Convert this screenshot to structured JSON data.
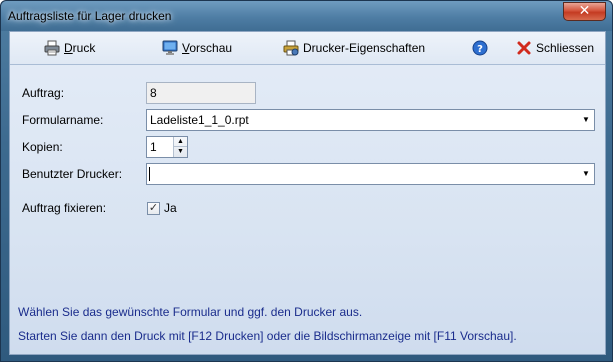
{
  "window": {
    "title": "Auftragsliste für Lager drucken",
    "close_glyph": "✕"
  },
  "toolbar": {
    "print_label": "Druck",
    "print_underline": "D",
    "preview_label": "Vorschau",
    "preview_underline": "V",
    "printer_props_label": "Drucker-Eigenschaften",
    "help_icon": "help-icon",
    "close_label": "Schliessen"
  },
  "form": {
    "order_label": "Auftrag:",
    "order_value": "8",
    "form_name_label": "Formularname:",
    "form_name_value": "Ladeliste1_1_0.rpt",
    "copies_label": "Kopien:",
    "copies_value": "1",
    "printer_label": "Benutzter Drucker:",
    "printer_value": "",
    "fix_label": "Auftrag fixieren:",
    "fix_checked": true,
    "fix_check_glyph": "✓",
    "fix_option_label": "Ja"
  },
  "info": {
    "line1": "Wählen Sie das gewünschte Formular und ggf. den Drucker aus.",
    "line2": "Starten Sie dann den Druck mit [F12 Drucken] oder die Bildschirmanzeige mit [F11 Vorschau]."
  },
  "colors": {
    "info_text": "#1a2c8c",
    "close_button": "#c43b22",
    "client_background": "#dce6f3"
  }
}
